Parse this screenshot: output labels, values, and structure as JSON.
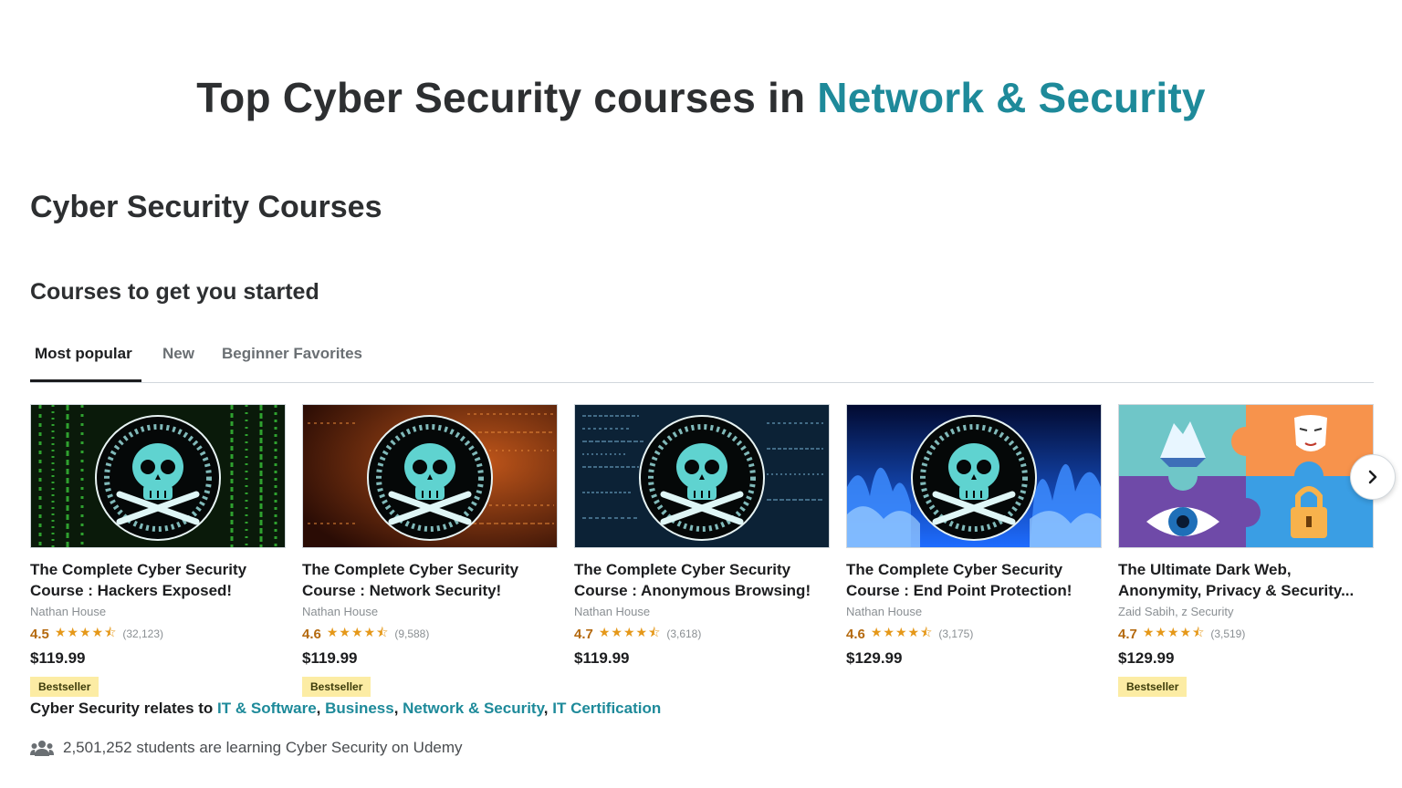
{
  "banner": {
    "prefix": "Top Cyber Security courses in ",
    "accent": "Network & Security",
    "accent_color": "#1e8a9a"
  },
  "section_title": "Cyber Security Courses",
  "subsection_title": "Courses to get you started",
  "tabs": [
    {
      "label": "Most popular",
      "active": true
    },
    {
      "label": "New",
      "active": false
    },
    {
      "label": "Beginner Favorites",
      "active": false
    }
  ],
  "courses": [
    {
      "title_line1": "The Complete Cyber Security",
      "title_line2": "Course : Hackers Exposed!",
      "author": "Nathan House",
      "rating": "4.5",
      "stars": "★★★★⯪",
      "reviews": "(32,123)",
      "price": "$119.99",
      "badge": "Bestseller",
      "thumb_icon": "skull-crossbones-icon"
    },
    {
      "title_line1": "The Complete Cyber Security",
      "title_line2": "Course : Network Security!",
      "author": "Nathan House",
      "rating": "4.6",
      "stars": "★★★★⯪",
      "reviews": "(9,588)",
      "price": "$119.99",
      "badge": "Bestseller",
      "thumb_icon": "skull-crossbones-icon"
    },
    {
      "title_line1": "The Complete Cyber Security",
      "title_line2": "Course : Anonymous Browsing!",
      "author": "Nathan House",
      "rating": "4.7",
      "stars": "★★★★⯪",
      "reviews": "(3,618)",
      "price": "$119.99",
      "badge": "",
      "thumb_icon": "skull-crossbones-icon"
    },
    {
      "title_line1": "The Complete Cyber Security",
      "title_line2": "Course : End Point Protection!",
      "author": "Nathan House",
      "rating": "4.6",
      "stars": "★★★★⯪",
      "reviews": "(3,175)",
      "price": "$129.99",
      "badge": "",
      "thumb_icon": "skull-crossbones-icon"
    },
    {
      "title_line1": "The Ultimate Dark Web,",
      "title_line2": "Anonymity, Privacy & Security...",
      "author": "Zaid Sabih, z Security",
      "rating": "4.7",
      "stars": "★★★★⯪",
      "reviews": "(3,519)",
      "price": "$129.99",
      "badge": "Bestseller",
      "thumb_icon": "puzzle-icon"
    }
  ],
  "next_button_icon": "chevron-right-icon",
  "relates": {
    "prefix": "Cyber Security relates to ",
    "links": [
      "IT & Software",
      "Business",
      "Network & Security",
      "IT Certification"
    ]
  },
  "learners": {
    "icon": "users-icon",
    "text": "2,501,252 students are learning Cyber Security on Udemy"
  },
  "colors": {
    "rating": "#b4690e",
    "stars": "#e59819",
    "badge_bg": "#fceca4",
    "link": "#1e8a9a"
  }
}
